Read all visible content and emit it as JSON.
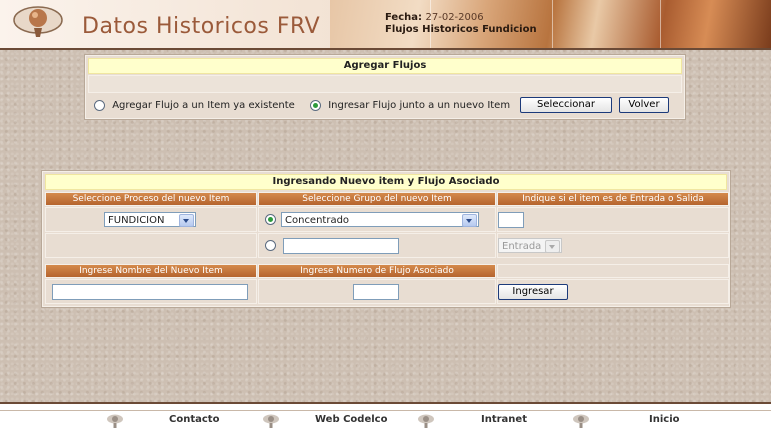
{
  "header": {
    "title": "Datos Historicos FRV",
    "fecha_label": "Fecha:",
    "fecha_value": "27-02-2006",
    "subtitle": "Flujos Historicos Fundicion"
  },
  "agregar": {
    "title": "Agregar Flujos",
    "option_existing": "Agregar Flujo a un Item ya existente",
    "option_new": "Ingresar Flujo junto a un nuevo Item",
    "selected_option": "new",
    "select_button": "Seleccionar",
    "back_button": "Volver"
  },
  "nuevo": {
    "title": "Ingresando Nuevo item y Flujo Asociado",
    "col_proceso": "Seleccione Proceso del nuevo Item",
    "col_grupo": "Seleccione Grupo del nuevo Item",
    "col_entrada_salida": "Indique si el item es de Entrada o Salida",
    "proceso_value": "FUNDICION",
    "grupo_value": "Concentrado",
    "grupo_radio_existing_selected": true,
    "nuevo_grupo_value": "",
    "entrada_salida_value": "Entrada",
    "entrada_salida_box_value": "",
    "col_nombre": "Ingrese Nombre del Nuevo Item",
    "col_flujo": "Ingrese Numero de Flujo Asociado",
    "nombre_value": "",
    "flujo_value": "",
    "submit_button": "Ingresar"
  },
  "footer": {
    "links": [
      "Contacto",
      "Web Codelco",
      "Intranet",
      "Inicio"
    ]
  },
  "colors": {
    "header_title": "#9b5a3a",
    "section_header_orange": "#c8753b",
    "title_bar_yellow": "#ffffcc",
    "background_beige": "#cdbfb2"
  }
}
